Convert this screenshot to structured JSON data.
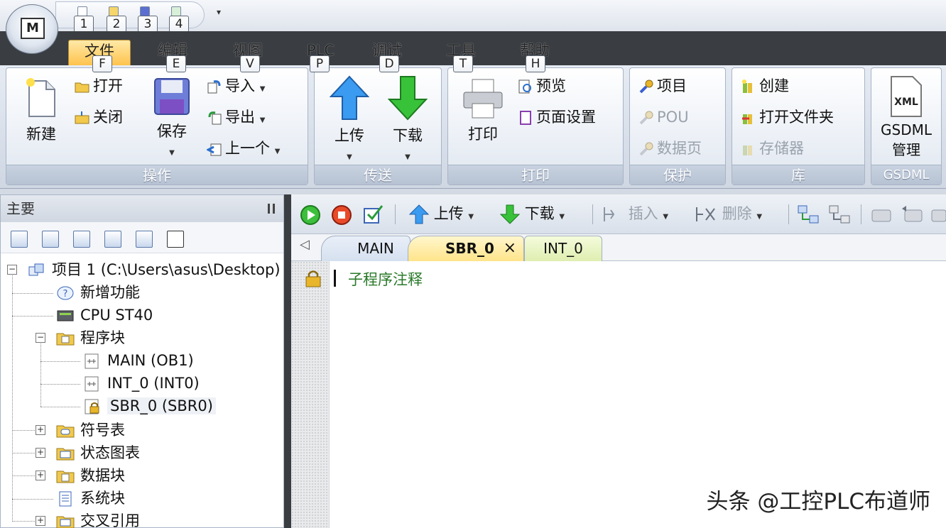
{
  "app": {
    "button_letter": "M"
  },
  "qat": {
    "keys": [
      "1",
      "2",
      "3",
      "4"
    ]
  },
  "menu": {
    "tabs": [
      {
        "label": "文件",
        "key": "F"
      },
      {
        "label": "编辑",
        "key": "E"
      },
      {
        "label": "视图",
        "key": "V"
      },
      {
        "label": "PLC",
        "key": "P"
      },
      {
        "label": "调试",
        "key": "D"
      },
      {
        "label": "工具",
        "key": "T"
      },
      {
        "label": "帮助",
        "key": "H"
      }
    ]
  },
  "ribbon": {
    "ops": {
      "label": "操作",
      "new": "新建",
      "open": "打开",
      "close": "关闭",
      "save": "保存",
      "import": "导入",
      "export": "导出",
      "previous": "上一个"
    },
    "transfer": {
      "label": "传送",
      "upload": "上传",
      "download": "下载"
    },
    "print": {
      "label": "打印",
      "print": "打印",
      "preview": "预览",
      "page_setup": "页面设置"
    },
    "protect": {
      "label": "保护",
      "project": "项目",
      "pou": "POU",
      "data_page": "数据页"
    },
    "library": {
      "label": "库",
      "create": "创建",
      "open_folder": "打开文件夹",
      "memory": "存储器"
    },
    "gsdml": {
      "label": "GSDML",
      "manage_line1": "GSDML",
      "manage_line2": "管理",
      "xml": "XML"
    }
  },
  "left_panel": {
    "title": "主要",
    "tree": {
      "project": "项目 1 (C:\\Users\\asus\\Desktop)",
      "new_features": "新增功能",
      "cpu": "CPU ST40",
      "program_block": "程序块",
      "main": "MAIN (OB1)",
      "int0": "INT_0 (INT0)",
      "sbr0": "SBR_0 (SBR0)",
      "symbol_table": "符号表",
      "status_chart": "状态图表",
      "data_block": "数据块",
      "system_block": "系统块",
      "cross_ref": "交叉引用"
    }
  },
  "editor": {
    "toolbar": {
      "upload": "上传",
      "download": "下载",
      "insert": "插入",
      "delete": "删除"
    },
    "tabs": [
      "MAIN",
      "SBR_0",
      "INT_0"
    ],
    "close_glyph": "×",
    "comment": "子程序注释"
  },
  "watermark": "头条 @工控PLC布道师",
  "colors": {
    "active_tab": "#ffc34d",
    "menubar": "#3a3d42",
    "comment": "#2a7a2a"
  }
}
